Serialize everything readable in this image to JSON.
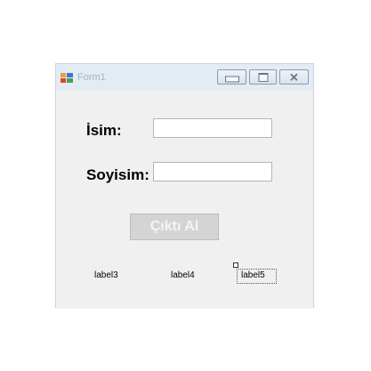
{
  "window": {
    "title": "Form1",
    "controls": {
      "minimize": "minimize",
      "maximize": "maximize",
      "close": "✕"
    }
  },
  "form": {
    "name_label": "İsim:",
    "surname_label": "Soyisim:",
    "name_value": "",
    "surname_value": "",
    "output_button": "Çıktı Al",
    "labels": [
      "label3",
      "label4",
      "label5"
    ]
  }
}
